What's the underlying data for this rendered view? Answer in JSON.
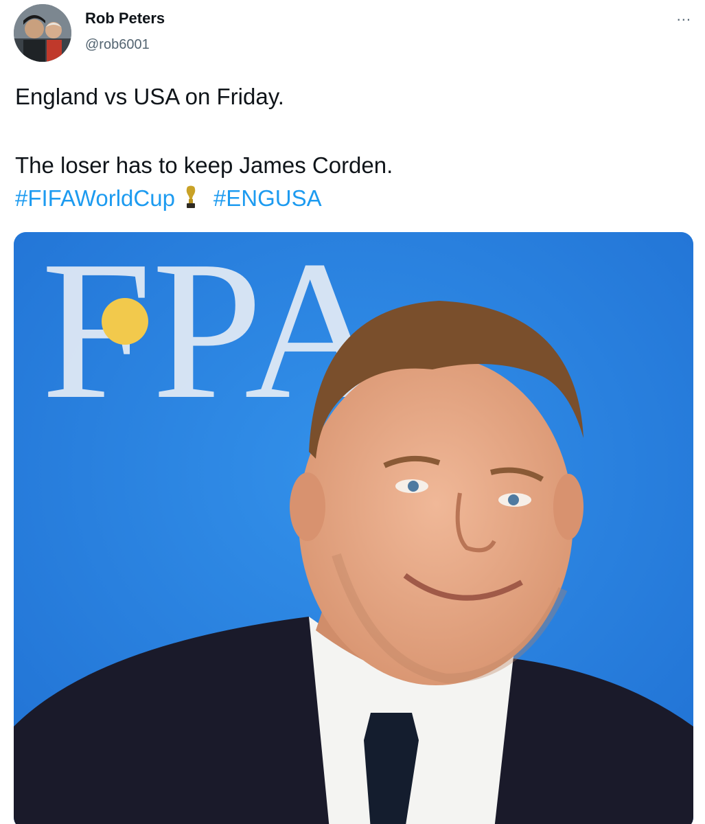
{
  "author": {
    "name": "Rob Peters",
    "handle": "@rob6001",
    "avatar_icon": "profile-photo"
  },
  "more_label": "...",
  "tweet": {
    "line1": "England vs USA on Friday.",
    "line2": "The loser has to keep James Corden.",
    "hashtags": [
      "#FIFAWorldCup",
      "#ENGUSA"
    ],
    "emoji": "trophy-icon"
  },
  "media": {
    "backdrop_text": "FPA",
    "backdrop_color": "#2a7fe0",
    "dot_color": "#f2c94c"
  },
  "colors": {
    "link": "#1d9bf0",
    "text": "#0f1419",
    "secondary": "#536471"
  }
}
